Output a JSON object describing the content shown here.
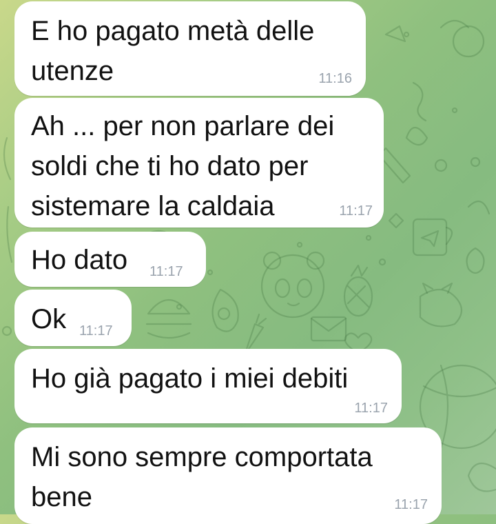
{
  "chat": {
    "messages": [
      {
        "lines": [
          "E ho pagato metà delle",
          "utenze"
        ],
        "time": "11:16"
      },
      {
        "lines": [
          "Ah ... per non parlare dei",
          "soldi che ti ho dato per",
          "sistemare la caldaia"
        ],
        "time": "11:17"
      },
      {
        "lines": [
          "Ho dato"
        ],
        "time": "11:17"
      },
      {
        "lines": [
          "Ok"
        ],
        "time": "11:17"
      },
      {
        "lines": [
          "Ho già pagato i miei debiti"
        ],
        "time": "11:17"
      },
      {
        "lines": [
          "Mi sono sempre comportata",
          "bene"
        ],
        "time": "11:17"
      }
    ]
  },
  "theme": {
    "bubble_color": "#ffffff",
    "text_color": "#111111",
    "time_color": "#9aa3ad",
    "wallpaper_colors": [
      "#c9d88a",
      "#8fc07f",
      "#9fc79a"
    ]
  }
}
